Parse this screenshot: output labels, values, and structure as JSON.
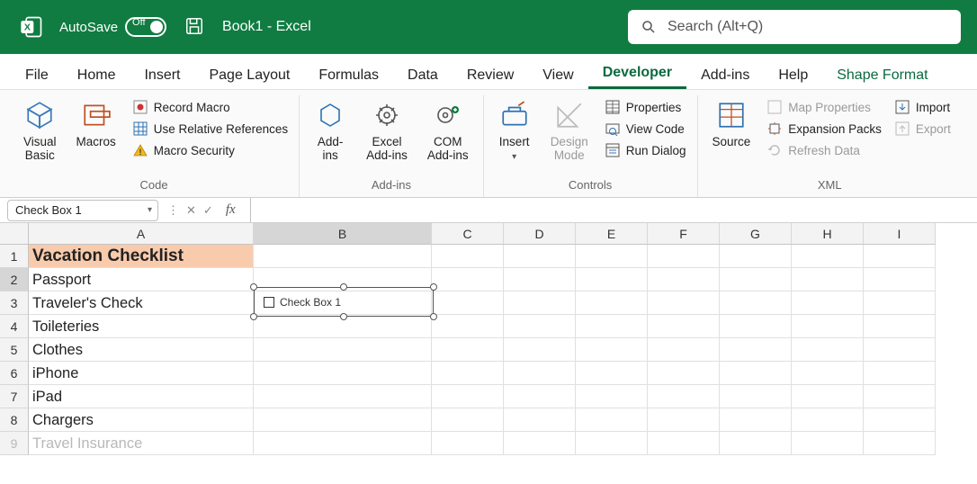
{
  "title_bar": {
    "autosave_label": "AutoSave",
    "autosave_state": "Off",
    "doc_title": "Book1  -  Excel"
  },
  "search": {
    "placeholder": "Search (Alt+Q)"
  },
  "tabs": {
    "file": "File",
    "home": "Home",
    "insert": "Insert",
    "page_layout": "Page Layout",
    "formulas": "Formulas",
    "data": "Data",
    "review": "Review",
    "view": "View",
    "developer": "Developer",
    "addins": "Add-ins",
    "help": "Help",
    "shape_format": "Shape Format"
  },
  "ribbon": {
    "code": {
      "visual_basic": "Visual\nBasic",
      "macros": "Macros",
      "record_macro": "Record Macro",
      "use_relative": "Use Relative References",
      "macro_security": "Macro Security",
      "label": "Code"
    },
    "addins": {
      "addins": "Add-\nins",
      "excel_addins": "Excel\nAdd-ins",
      "com_addins": "COM\nAdd-ins",
      "label": "Add-ins"
    },
    "controls": {
      "insert": "Insert",
      "design_mode": "Design\nMode",
      "properties": "Properties",
      "view_code": "View Code",
      "run_dialog": "Run Dialog",
      "label": "Controls"
    },
    "xml": {
      "source": "Source",
      "map_properties": "Map Properties",
      "expansion_packs": "Expansion Packs",
      "refresh_data": "Refresh Data",
      "import": "Import",
      "export": "Export",
      "label": "XML"
    }
  },
  "formula_bar": {
    "name_box": "Check Box 1",
    "fx": "fx"
  },
  "columns": [
    "A",
    "B",
    "C",
    "D",
    "E",
    "F",
    "G",
    "H",
    "I"
  ],
  "row_numbers": [
    "1",
    "2",
    "3",
    "4",
    "5",
    "6",
    "7",
    "8",
    "9"
  ],
  "cells": {
    "a1": "Vacation Checklist",
    "a2": "Passport",
    "a3": "Traveler's Check",
    "a4": "Toileteries",
    "a5": "Clothes",
    "a6": "iPhone",
    "a7": "iPad",
    "a8": "Chargers",
    "a9": "Travel Insurance"
  },
  "shape": {
    "label": "Check Box 1"
  }
}
